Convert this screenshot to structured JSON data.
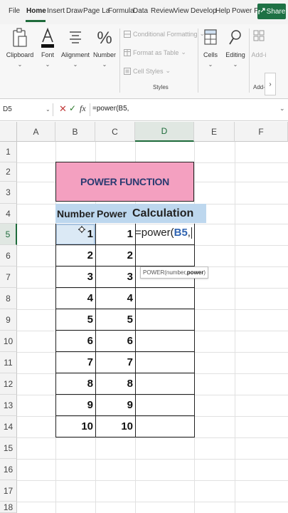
{
  "menu": {
    "tabs": [
      "File",
      "Home",
      "Insert",
      "Draw",
      "Page La",
      "Formula",
      "Data",
      "Review",
      "View",
      "Develop",
      "Help",
      "Power P"
    ],
    "active_tab": "Home",
    "share_label": "Share"
  },
  "ribbon": {
    "clipboard": "Clipboard",
    "font": "Font",
    "alignment": "Alignment",
    "number": "Number",
    "conditional_formatting": "Conditional Formatting",
    "format_as_table": "Format as Table",
    "cell_styles": "Cell Styles",
    "styles_group": "Styles",
    "cells": "Cells",
    "editing": "Editing",
    "addins": "Add-i",
    "addins_group": "Add-i"
  },
  "formula_bar": {
    "name_box": "D5",
    "formula": "=power(B5,",
    "fx_label": "fx"
  },
  "columns": [
    "A",
    "B",
    "C",
    "D",
    "E",
    "F"
  ],
  "rows": [
    "1",
    "2",
    "3",
    "4",
    "5",
    "6",
    "7",
    "8",
    "9",
    "10",
    "11",
    "12",
    "13",
    "14",
    "15",
    "16",
    "17",
    "18"
  ],
  "selected_column": "D",
  "selected_row": "5",
  "sheet": {
    "title": "POWER FUNCTION",
    "headers": {
      "number": "Number",
      "power": "Power",
      "calculation": "Calculation"
    },
    "numbers": [
      "1",
      "2",
      "3",
      "4",
      "5",
      "6",
      "7",
      "8",
      "9",
      "10"
    ],
    "powers": [
      "1",
      "2",
      "3",
      "4",
      "5",
      "6",
      "7",
      "8",
      "9",
      "10"
    ],
    "edit_prefix": "=power(",
    "edit_ref": "B5",
    "edit_suffix": ",",
    "tooltip_prefix": "POWER(number, ",
    "tooltip_bold": "power",
    "tooltip_suffix": ")"
  },
  "colors": {
    "title_fill": "#f4a0c0",
    "header_fill": "#bdd7ee",
    "excel_green": "#1e7145",
    "reference_blue": "#2f63b0"
  }
}
